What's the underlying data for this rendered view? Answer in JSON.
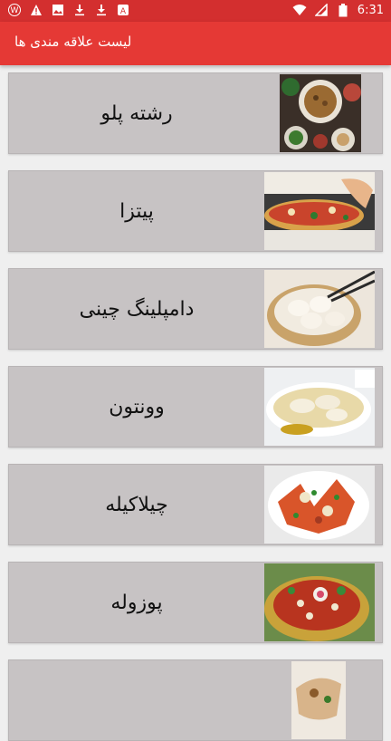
{
  "status_bar": {
    "time": "6:31",
    "left_icons": [
      "w-app-icon",
      "warning-icon",
      "image-icon",
      "download-icon",
      "download-icon",
      "a-app-icon"
    ],
    "right_icons": [
      "wifi-icon",
      "signal-icon",
      "battery-icon"
    ]
  },
  "app_bar": {
    "title": "لیست علاقه مندی ها",
    "color": "#e53935"
  },
  "items": [
    {
      "label": "رشته پلو",
      "image": "rice-dish-photo"
    },
    {
      "label": "پیتزا",
      "image": "pizza-photo"
    },
    {
      "label": "دامپلینگ چینی",
      "image": "dumplings-photo"
    },
    {
      "label": "وونتون",
      "image": "wonton-photo"
    },
    {
      "label": "چیلاکیله",
      "image": "chilaquiles-photo"
    },
    {
      "label": "پوزوله",
      "image": "pozole-photo"
    },
    {
      "label": "",
      "image": "food-photo"
    }
  ]
}
